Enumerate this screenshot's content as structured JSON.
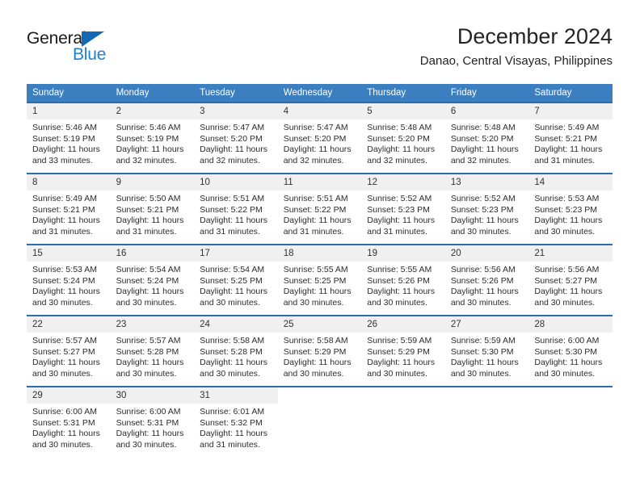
{
  "logo": {
    "word_top": "General",
    "word_bottom": "Blue",
    "accent_color": "#1268b3",
    "blue_text_color": "#1f7fd1"
  },
  "header": {
    "month_title": "December 2024",
    "location": "Danao, Central Visayas, Philippines"
  },
  "theme": {
    "header_bg": "#3c7fc1",
    "row_divider": "#2b6cad",
    "daynum_bg": "#f0f0f0"
  },
  "weekday_headers": [
    "Sunday",
    "Monday",
    "Tuesday",
    "Wednesday",
    "Thursday",
    "Friday",
    "Saturday"
  ],
  "weeks": [
    [
      {
        "day": "1",
        "sunrise": "Sunrise: 5:46 AM",
        "sunset": "Sunset: 5:19 PM",
        "daylight": "Daylight: 11 hours and 33 minutes."
      },
      {
        "day": "2",
        "sunrise": "Sunrise: 5:46 AM",
        "sunset": "Sunset: 5:19 PM",
        "daylight": "Daylight: 11 hours and 32 minutes."
      },
      {
        "day": "3",
        "sunrise": "Sunrise: 5:47 AM",
        "sunset": "Sunset: 5:20 PM",
        "daylight": "Daylight: 11 hours and 32 minutes."
      },
      {
        "day": "4",
        "sunrise": "Sunrise: 5:47 AM",
        "sunset": "Sunset: 5:20 PM",
        "daylight": "Daylight: 11 hours and 32 minutes."
      },
      {
        "day": "5",
        "sunrise": "Sunrise: 5:48 AM",
        "sunset": "Sunset: 5:20 PM",
        "daylight": "Daylight: 11 hours and 32 minutes."
      },
      {
        "day": "6",
        "sunrise": "Sunrise: 5:48 AM",
        "sunset": "Sunset: 5:20 PM",
        "daylight": "Daylight: 11 hours and 32 minutes."
      },
      {
        "day": "7",
        "sunrise": "Sunrise: 5:49 AM",
        "sunset": "Sunset: 5:21 PM",
        "daylight": "Daylight: 11 hours and 31 minutes."
      }
    ],
    [
      {
        "day": "8",
        "sunrise": "Sunrise: 5:49 AM",
        "sunset": "Sunset: 5:21 PM",
        "daylight": "Daylight: 11 hours and 31 minutes."
      },
      {
        "day": "9",
        "sunrise": "Sunrise: 5:50 AM",
        "sunset": "Sunset: 5:21 PM",
        "daylight": "Daylight: 11 hours and 31 minutes."
      },
      {
        "day": "10",
        "sunrise": "Sunrise: 5:51 AM",
        "sunset": "Sunset: 5:22 PM",
        "daylight": "Daylight: 11 hours and 31 minutes."
      },
      {
        "day": "11",
        "sunrise": "Sunrise: 5:51 AM",
        "sunset": "Sunset: 5:22 PM",
        "daylight": "Daylight: 11 hours and 31 minutes."
      },
      {
        "day": "12",
        "sunrise": "Sunrise: 5:52 AM",
        "sunset": "Sunset: 5:23 PM",
        "daylight": "Daylight: 11 hours and 31 minutes."
      },
      {
        "day": "13",
        "sunrise": "Sunrise: 5:52 AM",
        "sunset": "Sunset: 5:23 PM",
        "daylight": "Daylight: 11 hours and 30 minutes."
      },
      {
        "day": "14",
        "sunrise": "Sunrise: 5:53 AM",
        "sunset": "Sunset: 5:23 PM",
        "daylight": "Daylight: 11 hours and 30 minutes."
      }
    ],
    [
      {
        "day": "15",
        "sunrise": "Sunrise: 5:53 AM",
        "sunset": "Sunset: 5:24 PM",
        "daylight": "Daylight: 11 hours and 30 minutes."
      },
      {
        "day": "16",
        "sunrise": "Sunrise: 5:54 AM",
        "sunset": "Sunset: 5:24 PM",
        "daylight": "Daylight: 11 hours and 30 minutes."
      },
      {
        "day": "17",
        "sunrise": "Sunrise: 5:54 AM",
        "sunset": "Sunset: 5:25 PM",
        "daylight": "Daylight: 11 hours and 30 minutes."
      },
      {
        "day": "18",
        "sunrise": "Sunrise: 5:55 AM",
        "sunset": "Sunset: 5:25 PM",
        "daylight": "Daylight: 11 hours and 30 minutes."
      },
      {
        "day": "19",
        "sunrise": "Sunrise: 5:55 AM",
        "sunset": "Sunset: 5:26 PM",
        "daylight": "Daylight: 11 hours and 30 minutes."
      },
      {
        "day": "20",
        "sunrise": "Sunrise: 5:56 AM",
        "sunset": "Sunset: 5:26 PM",
        "daylight": "Daylight: 11 hours and 30 minutes."
      },
      {
        "day": "21",
        "sunrise": "Sunrise: 5:56 AM",
        "sunset": "Sunset: 5:27 PM",
        "daylight": "Daylight: 11 hours and 30 minutes."
      }
    ],
    [
      {
        "day": "22",
        "sunrise": "Sunrise: 5:57 AM",
        "sunset": "Sunset: 5:27 PM",
        "daylight": "Daylight: 11 hours and 30 minutes."
      },
      {
        "day": "23",
        "sunrise": "Sunrise: 5:57 AM",
        "sunset": "Sunset: 5:28 PM",
        "daylight": "Daylight: 11 hours and 30 minutes."
      },
      {
        "day": "24",
        "sunrise": "Sunrise: 5:58 AM",
        "sunset": "Sunset: 5:28 PM",
        "daylight": "Daylight: 11 hours and 30 minutes."
      },
      {
        "day": "25",
        "sunrise": "Sunrise: 5:58 AM",
        "sunset": "Sunset: 5:29 PM",
        "daylight": "Daylight: 11 hours and 30 minutes."
      },
      {
        "day": "26",
        "sunrise": "Sunrise: 5:59 AM",
        "sunset": "Sunset: 5:29 PM",
        "daylight": "Daylight: 11 hours and 30 minutes."
      },
      {
        "day": "27",
        "sunrise": "Sunrise: 5:59 AM",
        "sunset": "Sunset: 5:30 PM",
        "daylight": "Daylight: 11 hours and 30 minutes."
      },
      {
        "day": "28",
        "sunrise": "Sunrise: 6:00 AM",
        "sunset": "Sunset: 5:30 PM",
        "daylight": "Daylight: 11 hours and 30 minutes."
      }
    ],
    [
      {
        "day": "29",
        "sunrise": "Sunrise: 6:00 AM",
        "sunset": "Sunset: 5:31 PM",
        "daylight": "Daylight: 11 hours and 30 minutes."
      },
      {
        "day": "30",
        "sunrise": "Sunrise: 6:00 AM",
        "sunset": "Sunset: 5:31 PM",
        "daylight": "Daylight: 11 hours and 30 minutes."
      },
      {
        "day": "31",
        "sunrise": "Sunrise: 6:01 AM",
        "sunset": "Sunset: 5:32 PM",
        "daylight": "Daylight: 11 hours and 31 minutes."
      },
      null,
      null,
      null,
      null
    ]
  ]
}
